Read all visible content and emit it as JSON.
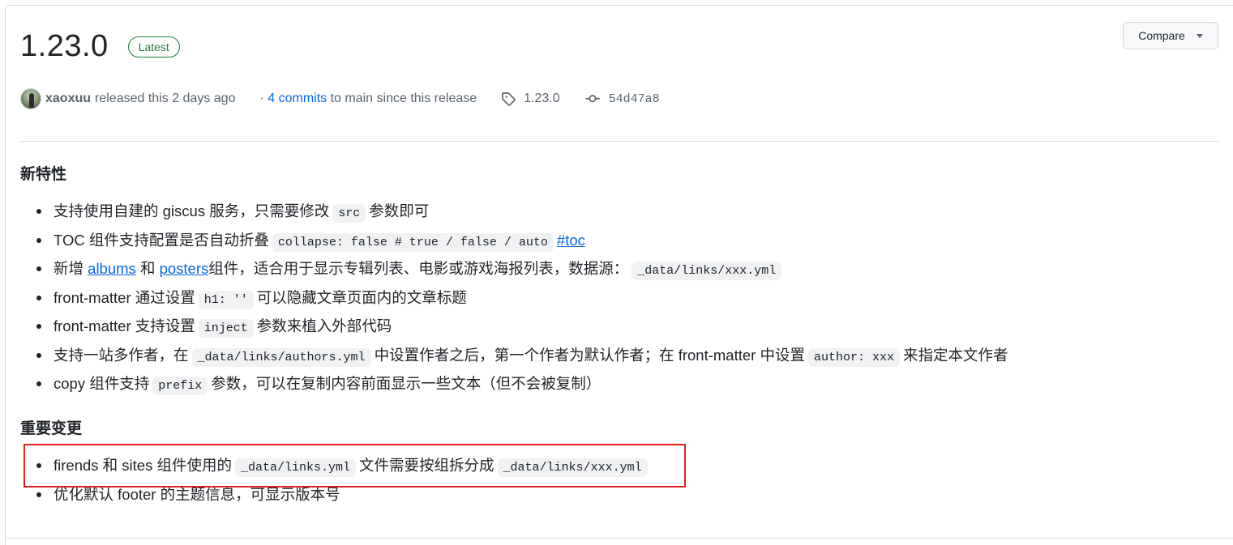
{
  "release": {
    "version": "1.23.0",
    "badge": "Latest",
    "compare_label": "Compare"
  },
  "meta": {
    "author": "xaoxuu",
    "released_text": "released this 2 days ago",
    "separator": "·",
    "commits_link": "4 commits",
    "commits_suffix": "to main since this release",
    "tag": "1.23.0",
    "commit_sha": "54d47a8"
  },
  "sections": {
    "features_title": "新特性",
    "breaking_title": "重要变更"
  },
  "features": {
    "f1": {
      "a": "支持使用自建的 giscus 服务，只需要修改",
      "code": "src",
      "b": "参数即可"
    },
    "f2": {
      "a": "TOC 组件支持配置是否自动折叠",
      "code": "collapse: false # true / false / auto",
      "link": "#toc"
    },
    "f3": {
      "a": "新增",
      "link1": "albums",
      "b": "和",
      "link2": "posters",
      "c": "组件，适合用于显示专辑列表、电影或游戏海报列表，数据源：",
      "code": "_data/links/xxx.yml"
    },
    "f4": {
      "a": "front-matter 通过设置",
      "code": "h1: ''",
      "b": "可以隐藏文章页面内的文章标题"
    },
    "f5": {
      "a": "front-matter 支持设置",
      "code": "inject",
      "b": "参数来植入外部代码"
    },
    "f6": {
      "a": "支持一站多作者，在",
      "code1": "_data/links/authors.yml",
      "b": "中设置作者之后，第一个作者为默认作者；在 front-matter 中设置",
      "code2": "author: xxx",
      "c": "来指定本文作者"
    },
    "f7": {
      "a": "copy 组件支持",
      "code": "prefix",
      "b": "参数，可以在复制内容前面显示一些文本（但不会被复制）"
    }
  },
  "breaking": {
    "b1": {
      "a": "firends 和 sites 组件使用的",
      "code1": "_data/links.yml",
      "b": "文件需要按组拆分成",
      "code2": "_data/links/xxx.yml"
    },
    "b2": {
      "a": "优化默认 footer 的主题信息，可显示版本号"
    }
  },
  "colors": {
    "link": "#0969da",
    "badge_green": "#1a7f37",
    "highlight_red": "#e0221f"
  },
  "icons": {
    "tag": "tag-icon",
    "commit": "git-commit-icon",
    "caret": "caret-down-icon"
  }
}
